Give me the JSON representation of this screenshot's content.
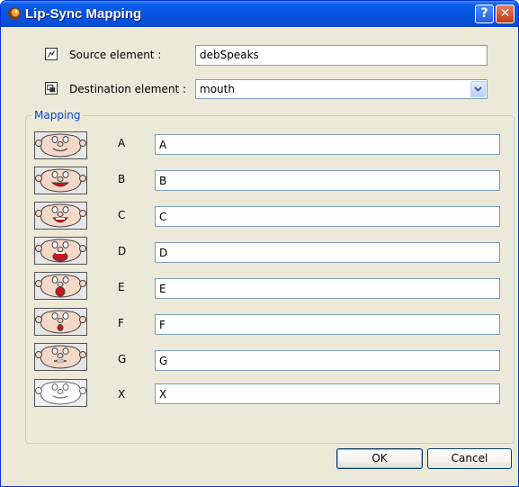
{
  "window": {
    "title": "Lip-Sync Mapping",
    "help_glyph": "?",
    "close_glyph": "✕"
  },
  "source": {
    "label": "Source element :",
    "value": "debSpeaks",
    "icon": "source-element-icon"
  },
  "destination": {
    "label": "Destination element :",
    "value": "mouth",
    "icon": "destination-element-icon"
  },
  "mapping": {
    "legend": "Mapping",
    "rows": [
      {
        "phoneme": "A",
        "value": "A"
      },
      {
        "phoneme": "B",
        "value": "B"
      },
      {
        "phoneme": "C",
        "value": "C"
      },
      {
        "phoneme": "D",
        "value": "D"
      },
      {
        "phoneme": "E",
        "value": "E"
      },
      {
        "phoneme": "F",
        "value": "F"
      },
      {
        "phoneme": "G",
        "value": "G"
      },
      {
        "phoneme": "X",
        "value": "X"
      }
    ]
  },
  "buttons": {
    "ok": "OK",
    "cancel": "Cancel"
  },
  "colors": {
    "titlebar": "#0554e3",
    "group_legend": "#0046d5",
    "dialog_bg": "#ece9d8",
    "mouth_red": "#c8161d"
  }
}
